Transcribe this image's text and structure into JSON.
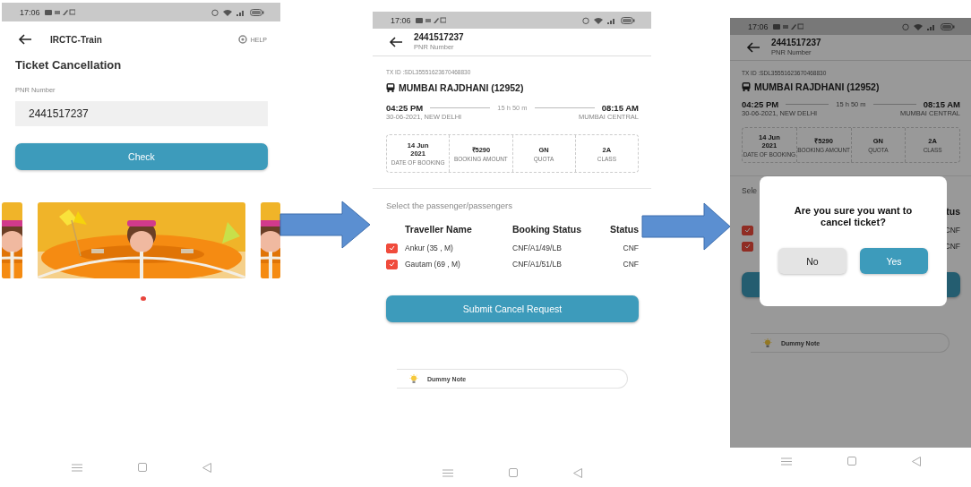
{
  "screens": [
    {
      "kind": "search",
      "status_bar": {
        "time": "17:06"
      },
      "header": {
        "title": "IRCTC-Train",
        "help": "HELP"
      },
      "heading": "Ticket Cancellation",
      "pnr_field": {
        "label": "PNR Number",
        "value": "2441517237"
      },
      "check_button": "Check",
      "carousel": [
        {
          "kind": "picture"
        },
        {
          "kind": "picture"
        },
        {
          "kind": "picture"
        }
      ],
      "page_dots": [
        {
          "selected": true
        }
      ]
    },
    {
      "kind": "details",
      "status_bar": {
        "time": "17:06"
      },
      "header": {
        "title": "2441517237",
        "subtitle": "PNR Number"
      },
      "tx_id": "TX ID :SDL35551623670468830",
      "train": "MUMBAI RAJDHANI (12952)",
      "departure": {
        "time": "04:25 PM",
        "place": "30-06-2021, NEW DELHI"
      },
      "duration": "15 h 50 m",
      "arrival": {
        "time": "08:15 AM",
        "place": "MUMBAI CENTRAL"
      },
      "info": [
        {
          "value": "14 Jun 2021",
          "label": "DATE OF BOOKING"
        },
        {
          "value": "₹5290",
          "label": "BOOKING AMOUNT"
        },
        {
          "value": "GN",
          "label": "QUOTA"
        },
        {
          "value": "2A",
          "label": "CLASS"
        }
      ],
      "section_label": "Select the passenger/passengers",
      "columns": [
        {
          "kind": "name",
          "text": "Traveller Name"
        },
        {
          "kind": "booking",
          "text": "Booking Status"
        },
        {
          "kind": "status",
          "text": "Status"
        }
      ],
      "passengers": [
        {
          "checked": true,
          "name": "Ankur (35 , M)",
          "booking_status": "CNF/A1/49/LB",
          "status": "CNF"
        },
        {
          "checked": true,
          "name": "Gautam (69 , M)",
          "booking_status": "CNF/A1/51/LB",
          "status": "CNF"
        }
      ],
      "submit_button": {
        "label": "Submit Cancel Request"
      },
      "note": "Dummy Note"
    },
    {
      "kind": "details",
      "status_bar": {
        "time": "17:06"
      },
      "header": {
        "title": "2441517237",
        "subtitle": "PNR Number"
      },
      "tx_id": "TX ID :SDL35551623670468830",
      "train": "MUMBAI RAJDHANI (12952)",
      "departure": {
        "time": "04:25 PM",
        "place": "30-06-2021, NEW DELHI"
      },
      "duration": "15 h 50 m",
      "arrival": {
        "time": "08:15 AM",
        "place": "MUMBAI CENTRAL"
      },
      "info": [
        {
          "value": "14 Jun 2021",
          "label": "DATE OF BOOKING"
        },
        {
          "value": "₹5290",
          "label": "BOOKING AMOUNT"
        },
        {
          "value": "GN",
          "label": "QUOTA"
        },
        {
          "value": "2A",
          "label": "CLASS"
        }
      ],
      "section_label": "Sele",
      "columns": [
        {
          "kind": "status",
          "text": "tus"
        }
      ],
      "passengers": [
        {
          "checked": true,
          "status": "CNF"
        },
        {
          "checked": true,
          "status": "CNF"
        }
      ],
      "note": "Dummy Note",
      "dialog": {
        "message": "Are you sure you want to cancel ticket?",
        "buttons": [
          {
            "kind": "secondary",
            "label": "No"
          },
          {
            "kind": "primary",
            "label": "Yes"
          }
        ]
      }
    }
  ]
}
